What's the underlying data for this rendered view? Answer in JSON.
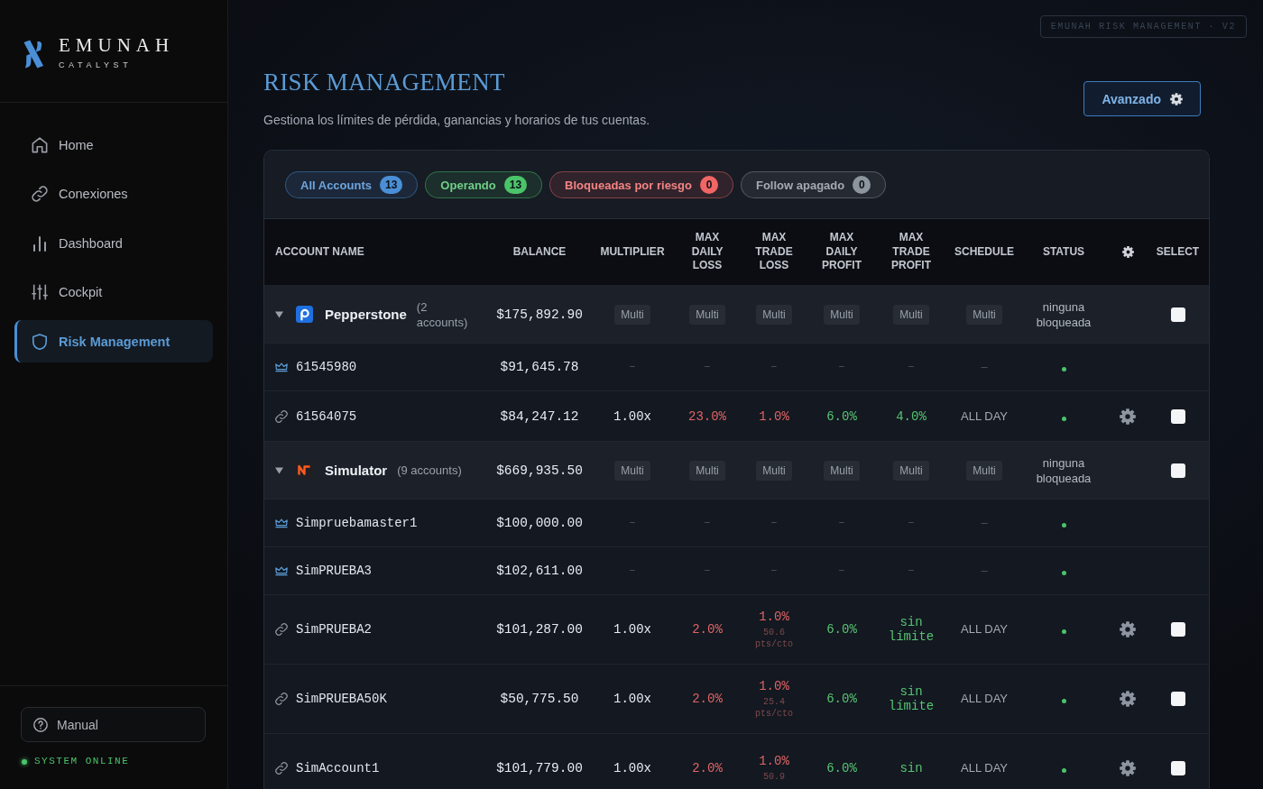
{
  "sidebar": {
    "brand": {
      "name": "EMUNAH",
      "tagline": "CATALYST"
    },
    "nav": [
      {
        "label": "Home",
        "selected": false
      },
      {
        "label": "Conexiones",
        "selected": false
      },
      {
        "label": "Dashboard",
        "selected": false
      },
      {
        "label": "Cockpit",
        "selected": false
      },
      {
        "label": "Risk Management",
        "selected": true
      }
    ],
    "manual_button": "Manual",
    "system_status": {
      "label": "SYSTEM ONLINE",
      "online": true
    }
  },
  "header": {
    "version_badge": "EMUNAH RISK MANAGEMENT · V2",
    "title": "RISK MANAGEMENT",
    "subtitle": "Gestiona los límites de pérdida, ganancias y horarios de tus cuentas.",
    "advanced_button": "Avanzado"
  },
  "filters": [
    {
      "label": "All Accounts",
      "count": "13",
      "color": "#4a8fd6"
    },
    {
      "label": "Operando",
      "count": "13",
      "color": "#4cc36a"
    },
    {
      "label": "Bloqueadas por riesgo",
      "count": "0",
      "color": "#f06565"
    },
    {
      "label": "Follow apagado",
      "count": "0",
      "color": "#8e959f"
    }
  ],
  "table": {
    "columns": [
      {
        "kind": "text",
        "label": "ACCOUNT NAME"
      },
      {
        "kind": "text",
        "label": "BALANCE"
      },
      {
        "kind": "text",
        "label": "MULTIPLIER"
      },
      {
        "kind": "text",
        "label": "MAX DAILY LOSS"
      },
      {
        "kind": "text",
        "label": "MAX TRADE LOSS"
      },
      {
        "kind": "text",
        "label": "MAX DAILY PROFIT"
      },
      {
        "kind": "text",
        "label": "MAX TRADE PROFIT"
      },
      {
        "kind": "text",
        "label": "SCHEDULE"
      },
      {
        "kind": "text",
        "label": "STATUS"
      },
      {
        "kind": "settings"
      },
      {
        "kind": "text",
        "label": "SELECT"
      }
    ],
    "groups": [
      {
        "name": "Pepperstone",
        "count": "(2 accounts)",
        "balance": "$175,892.90",
        "multiplier": "Multi",
        "max_daily_loss": "Multi",
        "max_trade_loss": "Multi",
        "max_daily_profit": "Multi",
        "max_trade_profit": "Multi",
        "schedule": "Multi",
        "status": "ninguna bloqueada",
        "expanded": true,
        "checked": false,
        "accounts": [
          {
            "kind": "master",
            "name": "61545980",
            "balance": "$91,645.78",
            "multiplier": "–",
            "max_daily_loss": "–",
            "max_trade_loss": "–",
            "max_daily_profit": "–",
            "max_trade_profit": "–",
            "schedule": "–",
            "active": true
          },
          {
            "kind": "follower",
            "name": "61564075",
            "balance": "$84,247.12",
            "multiplier": "1.00x",
            "max_daily_loss": "23.0%",
            "max_trade_loss": "1.0%",
            "max_daily_profit": "6.0%",
            "max_trade_profit": "4.0%",
            "schedule": "ALL DAY",
            "active": true,
            "checked": false
          }
        ]
      },
      {
        "name": "Simulator",
        "count": "(9 accounts)",
        "balance": "$669,935.50",
        "multiplier": "Multi",
        "max_daily_loss": "Multi",
        "max_trade_loss": "Multi",
        "max_daily_profit": "Multi",
        "max_trade_profit": "Multi",
        "schedule": "Multi",
        "status": "ninguna bloqueada",
        "expanded": true,
        "checked": false,
        "accounts": [
          {
            "kind": "master",
            "name": "Simpruebamaster1",
            "balance": "$100,000.00",
            "multiplier": "–",
            "max_daily_loss": "–",
            "max_trade_loss": "–",
            "max_daily_profit": "–",
            "max_trade_profit": "–",
            "schedule": "–",
            "active": true
          },
          {
            "kind": "master",
            "name": "SimPRUEBA3",
            "balance": "$102,611.00",
            "multiplier": "–",
            "max_daily_loss": "–",
            "max_trade_loss": "–",
            "max_daily_profit": "–",
            "max_trade_profit": "–",
            "schedule": "–",
            "active": true
          },
          {
            "kind": "follower",
            "name": "SimPRUEBA2",
            "balance": "$101,287.00",
            "multiplier": "1.00x",
            "max_daily_loss": "2.0%",
            "max_trade_loss": "1.0%",
            "max_trade_loss_note": "50.6 pts/cto",
            "max_daily_profit": "6.0%",
            "max_trade_profit": "sin límite",
            "schedule": "ALL DAY",
            "active": true,
            "checked": false
          },
          {
            "kind": "follower",
            "name": "SimPRUEBA50K",
            "balance": "$50,775.50",
            "multiplier": "1.00x",
            "max_daily_loss": "2.0%",
            "max_trade_loss": "1.0%",
            "max_trade_loss_note": "25.4 pts/cto",
            "max_daily_profit": "6.0%",
            "max_trade_profit": "sin límite",
            "schedule": "ALL DAY",
            "active": true,
            "checked": false
          },
          {
            "kind": "follower",
            "name": "SimAccount1",
            "balance": "$101,779.00",
            "multiplier": "1.00x",
            "max_daily_loss": "2.0%",
            "max_trade_loss": "1.0%",
            "max_trade_loss_note": "50.9",
            "max_daily_profit": "6.0%",
            "max_trade_profit": "sin",
            "schedule": "ALL DAY",
            "active": true,
            "checked": false
          }
        ]
      }
    ]
  }
}
